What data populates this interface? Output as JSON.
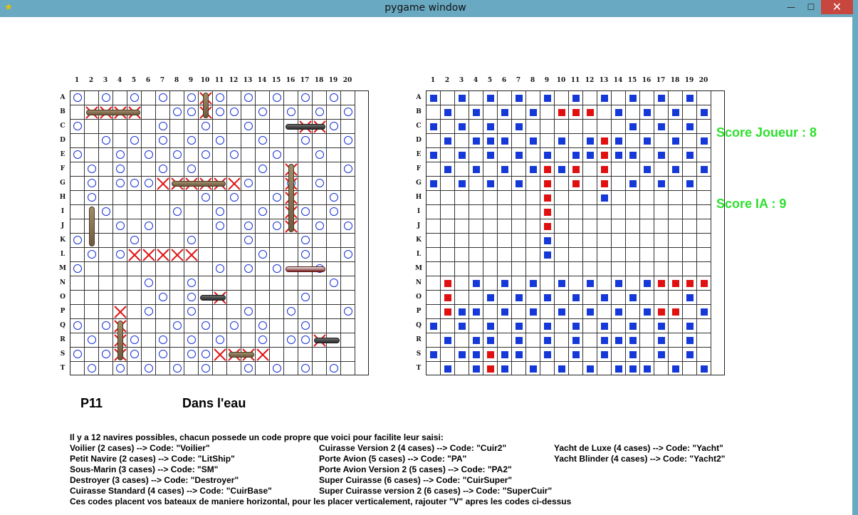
{
  "window": {
    "title": "pygame window",
    "icon": "pygame-icon",
    "minimize": "—",
    "maximize": "☐",
    "close": "✕"
  },
  "columns": [
    "1",
    "2",
    "3",
    "4",
    "5",
    "6",
    "7",
    "8",
    "9",
    "10",
    "11",
    "12",
    "13",
    "14",
    "15",
    "16",
    "17",
    "18",
    "19",
    "20"
  ],
  "rows": [
    "A",
    "B",
    "C",
    "D",
    "E",
    "F",
    "G",
    "H",
    "I",
    "J",
    "K",
    "L",
    "M",
    "N",
    "O",
    "P",
    "Q",
    "R",
    "S",
    "T"
  ],
  "colors": {
    "blue": "#1538d8",
    "red": "#e01010",
    "miss": "#1530d6",
    "hit": "#e01818",
    "score": "#2ee02e"
  },
  "player_board": {
    "misses": [
      "A1",
      "A3",
      "A5",
      "A7",
      "A9",
      "A11",
      "A13",
      "A15",
      "A17",
      "A19",
      "B8",
      "B9",
      "B11",
      "B12",
      "B14",
      "B16",
      "B18",
      "B20",
      "C1",
      "C7",
      "C10",
      "C13",
      "C19",
      "D3",
      "D5",
      "D7",
      "D9",
      "D11",
      "D14",
      "D17",
      "D20",
      "E1",
      "E4",
      "E6",
      "E8",
      "E10",
      "E12",
      "E15",
      "E18",
      "F2",
      "F4",
      "F7",
      "F9",
      "F14",
      "F20",
      "G2",
      "G4",
      "G5",
      "G6",
      "G13",
      "G16",
      "G18",
      "H2",
      "H10",
      "H12",
      "H15",
      "H19",
      "I3",
      "I8",
      "I11",
      "I14",
      "I17",
      "I19",
      "J4",
      "J6",
      "J11",
      "J13",
      "J15",
      "J18",
      "J20",
      "K1",
      "K5",
      "K9",
      "K13",
      "K17",
      "L2",
      "L4",
      "L14",
      "L17",
      "L20",
      "M1",
      "M11",
      "M13",
      "M15",
      "M18",
      "N6",
      "N9",
      "N19",
      "O7",
      "O9",
      "O17",
      "P6",
      "P9",
      "P13",
      "P16",
      "P20",
      "Q1",
      "Q3",
      "Q8",
      "Q10",
      "Q12",
      "Q14",
      "Q17",
      "R2",
      "R5",
      "R7",
      "R9",
      "R11",
      "R14",
      "R16",
      "R17",
      "S1",
      "S3",
      "S5",
      "S7",
      "S9",
      "S10",
      "T2",
      "T4",
      "T6",
      "T8",
      "T10",
      "T13",
      "T15",
      "T17",
      "T19"
    ],
    "hits": [
      "B2",
      "B3",
      "B4",
      "B5",
      "A10",
      "B10",
      "C17",
      "C18",
      "G7",
      "G8",
      "G9",
      "G10",
      "G11",
      "G12",
      "F16",
      "G16",
      "H16",
      "I16",
      "J16",
      "L5",
      "L6",
      "L7",
      "L8",
      "L9",
      "O11",
      "P4",
      "Q4",
      "R4",
      "S4",
      "R18",
      "S11",
      "S12",
      "S13",
      "S14"
    ],
    "ships": [
      {
        "name": "ship-b2-b5",
        "pos": "B2",
        "len": 4,
        "dir": "h",
        "kind": "tan"
      },
      {
        "name": "ship-a10-b10",
        "pos": "A10",
        "len": 2,
        "dir": "v",
        "kind": "tan"
      },
      {
        "name": "ship-c16-c18",
        "pos": "C16",
        "len": 3,
        "dir": "h",
        "kind": "dark"
      },
      {
        "name": "ship-g8-g11",
        "pos": "G8",
        "len": 4,
        "dir": "h",
        "kind": "tan"
      },
      {
        "name": "ship-f16-j16",
        "pos": "F16",
        "len": 5,
        "dir": "v",
        "kind": "tan"
      },
      {
        "name": "ship-i2-k2",
        "pos": "I2",
        "len": 3,
        "dir": "v",
        "kind": "tan"
      },
      {
        "name": "ship-m16-m18",
        "pos": "M16",
        "len": 3,
        "dir": "h",
        "kind": "boat"
      },
      {
        "name": "ship-o10-o11",
        "pos": "O10",
        "len": 2,
        "dir": "h",
        "kind": "dark"
      },
      {
        "name": "ship-q4-s4",
        "pos": "Q4",
        "len": 3,
        "dir": "v",
        "kind": "tan"
      },
      {
        "name": "ship-r18-r19",
        "pos": "R18",
        "len": 2,
        "dir": "h",
        "kind": "dark"
      },
      {
        "name": "ship-s12-s13",
        "pos": "S12",
        "len": 2,
        "dir": "h",
        "kind": "tan"
      }
    ]
  },
  "target_board": {
    "blue": [
      "A1",
      "A3",
      "A5",
      "A7",
      "A9",
      "A11",
      "A13",
      "A15",
      "A17",
      "A19",
      "B2",
      "B4",
      "B6",
      "B8",
      "B14",
      "B16",
      "B18",
      "B20",
      "C1",
      "C3",
      "C5",
      "C7",
      "C15",
      "C17",
      "C19",
      "D2",
      "D4",
      "D5",
      "D6",
      "D8",
      "D10",
      "D12",
      "D14",
      "D16",
      "D18",
      "D20",
      "E1",
      "E3",
      "E5",
      "E7",
      "E9",
      "E11",
      "E12",
      "E14",
      "E15",
      "E17",
      "E19",
      "F2",
      "F4",
      "F6",
      "F8",
      "F10",
      "F16",
      "F18",
      "F20",
      "G1",
      "G3",
      "G5",
      "G7",
      "G11",
      "G15",
      "G17",
      "G19",
      "H13",
      "K9",
      "L9",
      "N4",
      "N6",
      "N8",
      "N10",
      "N12",
      "N14",
      "N16",
      "O5",
      "O7",
      "O9",
      "O11",
      "O13",
      "O15",
      "O19",
      "P3",
      "P4",
      "P6",
      "P8",
      "P10",
      "P12",
      "P14",
      "P16",
      "P20",
      "Q1",
      "Q3",
      "Q5",
      "Q7",
      "Q9",
      "Q11",
      "Q13",
      "Q15",
      "Q17",
      "Q19",
      "R2",
      "R4",
      "R5",
      "R7",
      "R9",
      "R11",
      "R13",
      "R14",
      "R15",
      "R17",
      "R19",
      "S1",
      "S3",
      "S4",
      "S6",
      "S7",
      "S9",
      "S11",
      "S13",
      "S15",
      "S17",
      "S19",
      "T2",
      "T4",
      "T6",
      "T8",
      "T10",
      "T12",
      "T14",
      "T15",
      "T16",
      "T18",
      "T20"
    ],
    "red": [
      "B10",
      "B11",
      "B12",
      "D13",
      "E13",
      "F9",
      "F11",
      "F13",
      "G9",
      "G11",
      "G13",
      "H9",
      "I9",
      "J9",
      "N2",
      "N17",
      "N18",
      "N19",
      "N20",
      "O2",
      "P2",
      "P17",
      "P18",
      "S5",
      "T5"
    ]
  },
  "scores": {
    "player": "Score Joueur : 8",
    "ai": "Score IA : 9"
  },
  "status": {
    "last_shot": "P11",
    "result": "Dans l'eau"
  },
  "instructions": {
    "intro": "Il y a 12 navires possibles, chacun possede un code propre que voici pour facilite leur saisi:",
    "col1": [
      "Voilier (2 cases) --> Code: \"Voilier\"",
      "Petit Navire (2 cases) --> Code: \"LitShip\"",
      "Sous-Marin (3 cases) --> Code: \"SM\"",
      "Destroyer (3 cases) --> Code: \"Destroyer\"",
      "Cuirasse Standard (4 cases) --> Code: \"CuirBase\""
    ],
    "col2": [
      "Cuirasse Version 2 (4 cases) --> Code: \"Cuir2\"",
      "Porte Avion (5 cases) --> Code: \"PA\"",
      "Porte Avion Version 2 (5 cases) --> Code: \"PA2\"",
      "Super Cuirasse (6 cases) --> Code: \"CuirSuper\"",
      "Super Cuirasse version 2 (6 cases) --> Code: \"SuperCuir\""
    ],
    "col3": [
      "Yacht de Luxe (4 cases) --> Code: \"Yacht\"",
      "Yacht Blinder (4 cases) --> Code: \"Yacht2\""
    ],
    "footer": "Ces codes placent vos bateaux de maniere horizontal, pour les placer verticalement, rajouter \"V\" apres les codes ci-dessus"
  }
}
